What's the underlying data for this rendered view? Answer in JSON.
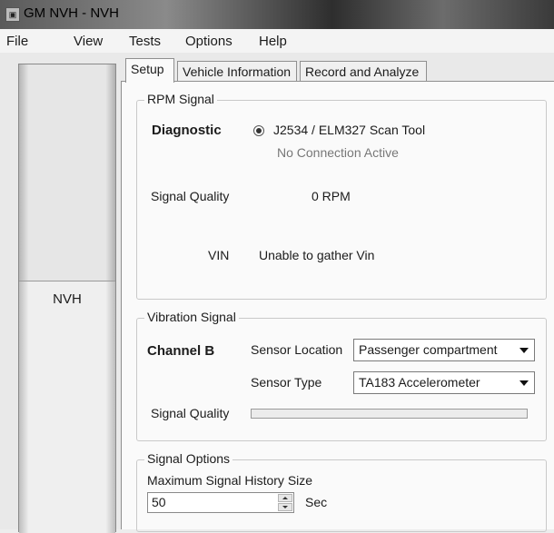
{
  "window": {
    "title": "GM NVH - NVH"
  },
  "menu": {
    "items": [
      "File",
      "View",
      "Tests",
      "Options",
      "Help"
    ]
  },
  "left_pane": {
    "label": "NVH"
  },
  "tabs": [
    "Setup",
    "Vehicle Information",
    "Record and Analyze"
  ],
  "rpm": {
    "title": "RPM Signal",
    "diagnostic_label": "Diagnostic",
    "source_option": "J2534 / ELM327 Scan Tool",
    "connection_status": "No Connection Active",
    "quality_label": "Signal Quality",
    "rpm_value": "0 RPM",
    "vin_label": "VIN",
    "vin_value": "Unable to gather Vin"
  },
  "vibration": {
    "title": "Vibration Signal",
    "channel_label": "Channel B",
    "location_label": "Sensor Location",
    "location_value": "Passenger compartment",
    "type_label": "Sensor Type",
    "type_value": "TA183 Accelerometer",
    "quality_label": "Signal Quality",
    "quality_level": 0
  },
  "options": {
    "title": "Signal Options",
    "history_label": "Maximum Signal History Size",
    "history_value": "50",
    "unit": "Sec"
  }
}
